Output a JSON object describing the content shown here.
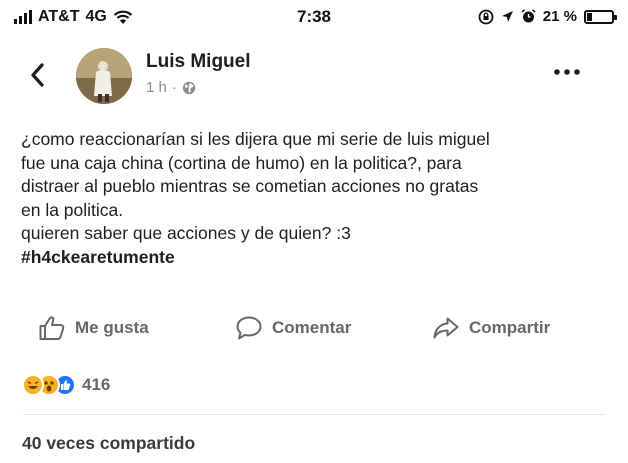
{
  "status_bar": {
    "carrier": "AT&T",
    "network": "4G",
    "time": "7:38",
    "battery": "21 %",
    "battery_level": 0.21
  },
  "post": {
    "author": "Luis Miguel",
    "time_ago": "1 h",
    "separator": "·",
    "privacy_icon": "globe-icon",
    "text_lines": [
      "¿como reaccionarían si les dijera que mi serie de luis miguel",
      "fue una caja china (cortina de humo) en la politica?, para",
      "distraer al pueblo mientras se cometian acciones no gratas",
      "en la politica.",
      "quieren saber que acciones y de quien? :3"
    ],
    "hashtag": "#h4ckearetumente"
  },
  "actions": {
    "like": "Me gusta",
    "comment": "Comentar",
    "share": "Compartir"
  },
  "reactions": {
    "icons": [
      "haha-icon",
      "wow-icon",
      "like-icon"
    ],
    "count": "416"
  },
  "shares": "40 veces compartido",
  "colors": {
    "text": "#1c1e21",
    "muted": "#65676b",
    "like_blue": "#1877f2",
    "reaction_yellow": "#f7b125"
  }
}
